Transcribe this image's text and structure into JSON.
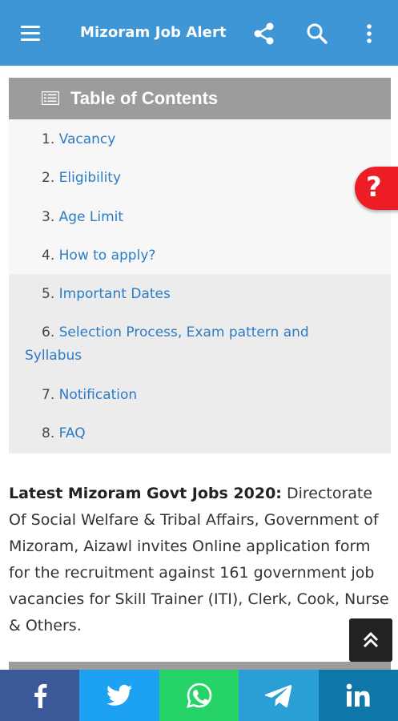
{
  "appbar": {
    "title": "Mizoram Job Alert",
    "icons": [
      "menu-icon",
      "share-icon",
      "search-icon",
      "more-vert-icon"
    ],
    "color": "#3e96d6"
  },
  "toc": {
    "title": "Table of Contents",
    "items": [
      {
        "num": "1.",
        "label": "Vacancy"
      },
      {
        "num": "2.",
        "label": "Eligibility"
      },
      {
        "num": "3.",
        "label": "Age Limit"
      },
      {
        "num": "4.",
        "label": "How to apply?"
      },
      {
        "num": "5.",
        "label": "Important Dates"
      },
      {
        "num": "6.",
        "label": "Selection Process, Exam pattern and",
        "label_cont": "Syllabus"
      },
      {
        "num": "7.",
        "label": "Notification"
      },
      {
        "num": "8.",
        "label": "FAQ"
      }
    ]
  },
  "article": {
    "bold": "Latest Mizoram Govt Jobs 2020:",
    "text": " Directorate Of Social Welfare & Tribal Affairs, Government of Mizoram, Aizawl invites Online application form for the recruitment against 161 government job vacancies for Skill Trainer (ITI), Clerk, Cook, Nurse & Others."
  },
  "help_button": {
    "label": "?",
    "color": "#ee1c24"
  },
  "share": [
    {
      "name": "facebook",
      "icon": "facebook-icon",
      "color": "#3b5998"
    },
    {
      "name": "twitter",
      "icon": "twitter-icon",
      "color": "#1da1f2"
    },
    {
      "name": "whatsapp",
      "icon": "whatsapp-icon",
      "color": "#25d366"
    },
    {
      "name": "telegram",
      "icon": "telegram-icon",
      "color": "#2a9fd6"
    },
    {
      "name": "linkedin",
      "icon": "linkedin-icon",
      "color": "#0e76a8"
    }
  ]
}
